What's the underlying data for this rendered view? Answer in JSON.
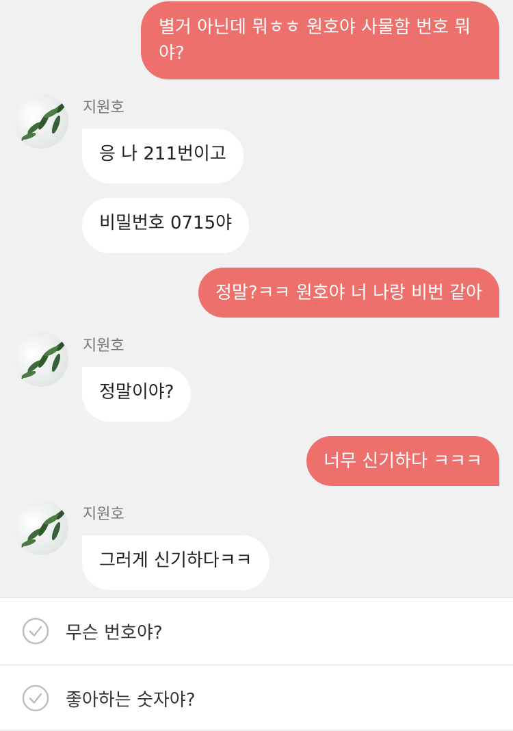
{
  "messages": [
    {
      "id": "m1",
      "dir": "out",
      "lines": [
        "별거 아닌데 뭐ㅎㅎ 원호야 사물함 번호 뭐",
        "야?"
      ]
    },
    {
      "id": "m2",
      "dir": "in",
      "text": "응 나 211번이고"
    },
    {
      "id": "m3",
      "dir": "in",
      "text": "비밀번호 0715야"
    },
    {
      "id": "m4",
      "dir": "out",
      "text": "정말?ㅋㅋ 원호야 너 나랑 비번 같아"
    },
    {
      "id": "m5",
      "dir": "in",
      "text": "정말이야?"
    },
    {
      "id": "m6",
      "dir": "out",
      "text": "너무 신기하다 ㅋㅋㅋ"
    },
    {
      "id": "m7",
      "dir": "in",
      "text": "그러게 신기하다ㅋㅋ"
    }
  ],
  "contact": {
    "name": "지원호"
  },
  "avatar_icon": "leaf-photo-avatar",
  "quick_replies": [
    {
      "label": "무슨 번호야?",
      "icon": "checkmark-circle-icon"
    },
    {
      "label": "좋아하는 숫자야?",
      "icon": "checkmark-circle-icon"
    }
  ],
  "colors": {
    "outgoing": "#ee706c",
    "incoming": "#ffffff",
    "background": "#f1f1f1"
  }
}
